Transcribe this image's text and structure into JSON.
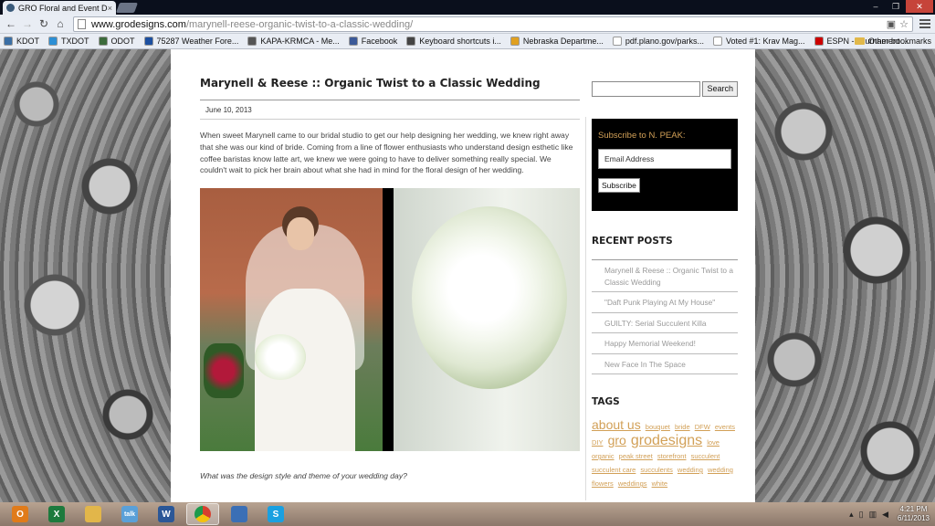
{
  "browser": {
    "tab_title": "GRO Floral and Event Desi",
    "url_domain": "www.grodesigns.com",
    "url_path": "/marynell-reese-organic-twist-to-a-classic-wedding/",
    "bookmarks": [
      {
        "label": "KDOT",
        "color": "#3a6ea5"
      },
      {
        "label": "TXDOT",
        "color": "#2d8fd5"
      },
      {
        "label": "ODOT",
        "color": "#3c6b3c"
      },
      {
        "label": "75287 Weather Fore...",
        "color": "#1c4fa0"
      },
      {
        "label": "KAPA-KRMCA - Me...",
        "color": "#555555"
      },
      {
        "label": "Facebook",
        "color": "#3b5998"
      },
      {
        "label": "Keyboard shortcuts i...",
        "color": "#444444"
      },
      {
        "label": "Nebraska Departme...",
        "color": "#e0a020"
      },
      {
        "label": "pdf.plano.gov/parks...",
        "color": "#ffffff"
      },
      {
        "label": "Voted #1: Krav Mag...",
        "color": "#ffffff"
      },
      {
        "label": "ESPN - Tournament ...",
        "color": "#cc0000"
      }
    ],
    "other_bookmarks": "Other bookmarks"
  },
  "post": {
    "title": "Marynell & Reese :: Organic Twist to a Classic Wedding",
    "date": "June 10, 2013",
    "body": "When sweet Marynell came to our bridal studio to get our help designing her wedding, we knew right away that she was our kind of bride. Coming from a line of flower enthusiasts who understand design esthetic like coffee baristas know latte art, we knew we were going to have to deliver something really special. We couldn't wait to pick her brain about what she had in mind for the floral design of her wedding.",
    "question": "What was the design style and theme of your wedding day?"
  },
  "sidebar": {
    "search_button": "Search",
    "subscribe_heading": "Subscribe to N. PEAK:",
    "email_placeholder": "Email Address",
    "subscribe_button": "Subscribe",
    "recent_heading": "RECENT POSTS",
    "recent_posts": [
      "Marynell & Reese :: Organic Twist to a Classic Wedding",
      "\"Daft Punk Playing At My House\"",
      "GUILTY: Serial Succulent Killa",
      "Happy Memorial Weekend!",
      "New Face In The Space"
    ],
    "tags_heading": "TAGS",
    "tags": [
      {
        "label": "about us",
        "size": "s14"
      },
      {
        "label": "bouquet",
        "size": "s8"
      },
      {
        "label": "bride",
        "size": "s8"
      },
      {
        "label": "DFW",
        "size": "s8"
      },
      {
        "label": "events",
        "size": "s8"
      },
      {
        "label": "DIY",
        "size": "s8"
      },
      {
        "label": "gro",
        "size": "s14"
      },
      {
        "label": "grodesigns",
        "size": "s16"
      },
      {
        "label": "love",
        "size": "s8"
      },
      {
        "label": "organic",
        "size": "s8"
      },
      {
        "label": "peak street",
        "size": "s8"
      },
      {
        "label": "storefront",
        "size": "s8"
      },
      {
        "label": "succulent",
        "size": "s8"
      },
      {
        "label": "succulent care",
        "size": "s8"
      },
      {
        "label": "succulents",
        "size": "s8"
      },
      {
        "label": "wedding",
        "size": "s8"
      },
      {
        "label": "wedding flowers",
        "size": "s8"
      },
      {
        "label": "weddings",
        "size": "s8"
      },
      {
        "label": "white",
        "size": "s8"
      }
    ]
  },
  "taskbar": {
    "apps": [
      {
        "name": "outlook",
        "letter": "O",
        "color": "#e07b1a"
      },
      {
        "name": "excel",
        "letter": "X",
        "color": "#1d7a3d"
      },
      {
        "name": "explorer",
        "letter": "",
        "color": "#e2b64a"
      },
      {
        "name": "talk",
        "letter": "talk",
        "color": "#5aa0d8"
      },
      {
        "name": "word",
        "letter": "W",
        "color": "#2b5797"
      },
      {
        "name": "chrome",
        "letter": "",
        "color": "#d7402f"
      },
      {
        "name": "network",
        "letter": "",
        "color": "#3b6fb5"
      },
      {
        "name": "skype",
        "letter": "S",
        "color": "#1aa0e0"
      }
    ],
    "time": "4:21 PM",
    "date": "6/11/2013"
  },
  "colors": {
    "accent_gold": "#d2a057",
    "link_gray": "#999999"
  }
}
